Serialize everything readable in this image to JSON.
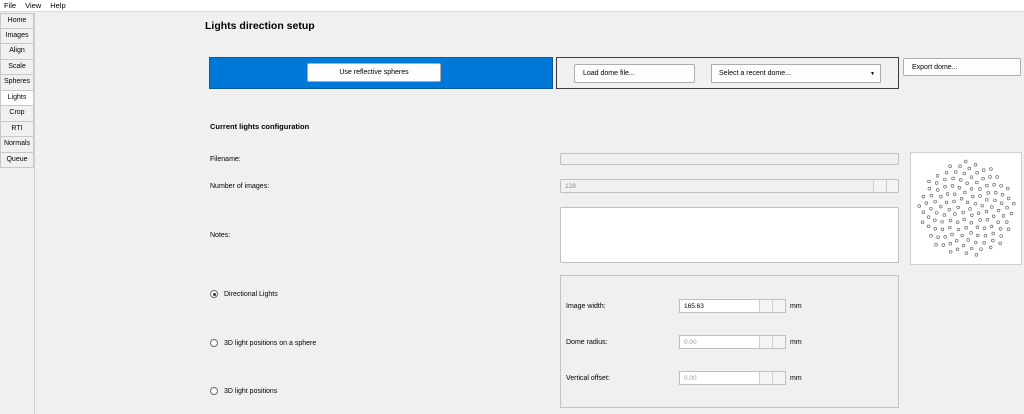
{
  "menu": {
    "file": "File",
    "view": "View",
    "help": "Help"
  },
  "sidebar": {
    "items": [
      {
        "label": "Home"
      },
      {
        "label": "Images"
      },
      {
        "label": "Align"
      },
      {
        "label": "Scale"
      },
      {
        "label": "Spheres"
      },
      {
        "label": "Lights"
      },
      {
        "label": "Crop"
      },
      {
        "label": "RTI"
      },
      {
        "label": "Normals"
      },
      {
        "label": "Queue"
      }
    ],
    "active": "Lights"
  },
  "page": {
    "title": "Lights direction setup",
    "use_spheres_label": "Use reflective spheres",
    "load_dome_label": "Load dome file...",
    "recent_dome_placeholder": "Select a recent dome...",
    "export_dome_label": "Export dome...",
    "accent_color": "#0078d7"
  },
  "config": {
    "section_title": "Current lights configuration",
    "filename_label": "Filename:",
    "filename_value": "",
    "images_label": "Number of images:",
    "images_value": "128",
    "notes_label": "Notes:",
    "notes_value": ""
  },
  "lights_mode": {
    "options": [
      {
        "label": "Directional Lights",
        "checked": true
      },
      {
        "label": "3D light positions on a sphere",
        "checked": false
      },
      {
        "label": "3D light positions",
        "checked": false
      }
    ]
  },
  "geometry": {
    "image_width_label": "Image width:",
    "image_width_value": "165.63",
    "dome_radius_label": "Dome radius:",
    "dome_radius_value": "0.00",
    "vertical_offset_label": "Vertical offset:",
    "vertical_offset_value": "0.00",
    "unit": "mm"
  }
}
